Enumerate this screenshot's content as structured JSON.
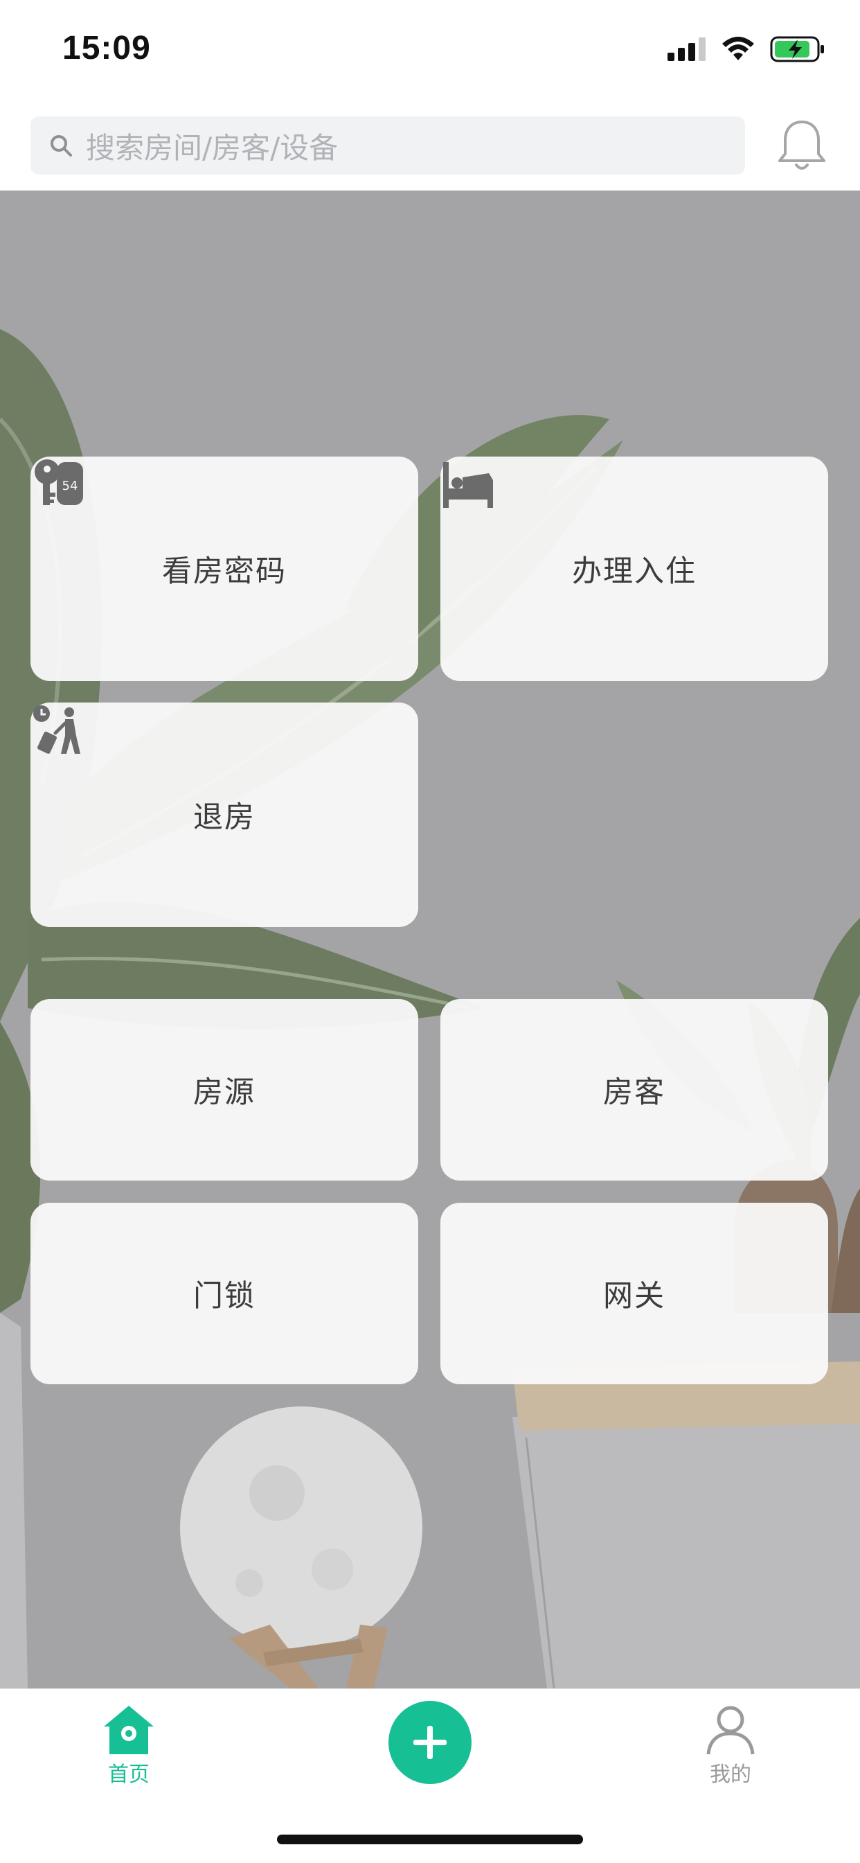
{
  "status_bar": {
    "time": "15:09",
    "icons": [
      "signal-icon",
      "wifi-icon",
      "battery-charging-icon"
    ]
  },
  "search": {
    "placeholder": "搜索房间/房客/设备",
    "icon": "search-icon"
  },
  "header": {
    "bell_icon": "bell-icon"
  },
  "quick_actions": [
    {
      "label": "看房密码",
      "icon": "keys-icon"
    },
    {
      "label": "办理入住",
      "icon": "bed-icon"
    },
    {
      "label": "退房",
      "icon": "checkout-traveler-icon"
    }
  ],
  "modules": [
    {
      "label": "房源"
    },
    {
      "label": "房客"
    },
    {
      "label": "门锁"
    },
    {
      "label": "网关"
    }
  ],
  "tabbar": {
    "home_label": "首页",
    "mine_label": "我的",
    "add_icon": "plus-icon",
    "active_color": "#17bf94",
    "inactive_color": "#9a9a9a"
  }
}
